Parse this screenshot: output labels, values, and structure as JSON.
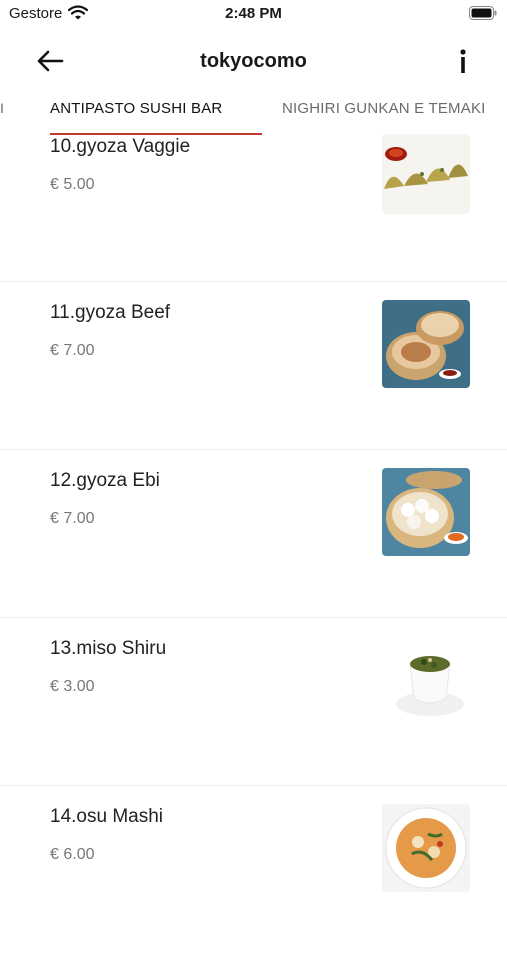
{
  "status_bar": {
    "carrier": "Gestore",
    "time": "2:48 PM"
  },
  "nav": {
    "title": "tokyocomo",
    "back_icon": "arrow-left-icon",
    "info_icon": "info-icon"
  },
  "tabs": {
    "partial_label": "I",
    "active_label": "ANTIPASTO SUSHI BAR",
    "next_label": "NIGHIRI GUNKAN E TEMAKI",
    "indicator_color": "#c0392b"
  },
  "menu_items": [
    {
      "name": "10.gyoza Vaggie",
      "price": "€ 5.00",
      "image": "gyoza-vaggie-photo"
    },
    {
      "name": "11.gyoza Beef",
      "price": "€ 7.00",
      "image": "gyoza-beef-photo"
    },
    {
      "name": "12.gyoza Ebi",
      "price": "€ 7.00",
      "image": "gyoza-ebi-photo"
    },
    {
      "name": "13.miso Shiru",
      "price": "€ 3.00",
      "image": "miso-soup-photo"
    },
    {
      "name": "14.osu Mashi",
      "price": "€ 6.00",
      "image": "osu-mashi-photo"
    }
  ]
}
